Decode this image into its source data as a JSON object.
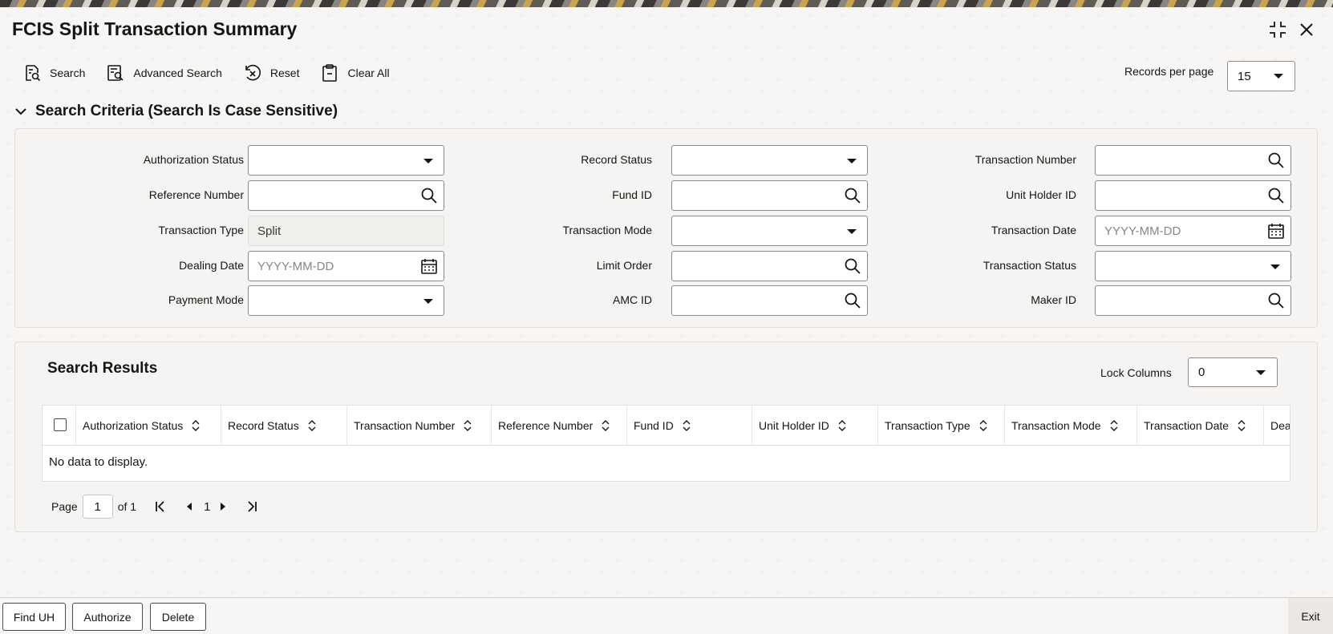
{
  "window": {
    "title": "FCIS Split Transaction Summary"
  },
  "toolbar": {
    "search_label": "Search",
    "advanced_search_label": "Advanced Search",
    "reset_label": "Reset",
    "clear_all_label": "Clear All"
  },
  "records_per_page": {
    "label": "Records per page",
    "value": "15"
  },
  "criteria": {
    "title": "Search Criteria (Search Is Case Sensitive)",
    "authorization_status": {
      "label": "Authorization Status",
      "value": ""
    },
    "record_status": {
      "label": "Record Status",
      "value": ""
    },
    "transaction_number": {
      "label": "Transaction Number",
      "value": ""
    },
    "reference_number": {
      "label": "Reference Number",
      "value": ""
    },
    "fund_id": {
      "label": "Fund ID",
      "value": ""
    },
    "unit_holder_id": {
      "label": "Unit Holder ID",
      "value": ""
    },
    "transaction_type": {
      "label": "Transaction Type",
      "value": "Split"
    },
    "transaction_mode": {
      "label": "Transaction Mode",
      "value": ""
    },
    "transaction_date": {
      "label": "Transaction Date",
      "placeholder": "YYYY-MM-DD"
    },
    "dealing_date": {
      "label": "Dealing Date",
      "placeholder": "YYYY-MM-DD"
    },
    "limit_order": {
      "label": "Limit Order",
      "value": ""
    },
    "transaction_status": {
      "label": "Transaction Status",
      "value": ""
    },
    "payment_mode": {
      "label": "Payment Mode",
      "value": ""
    },
    "amc_id": {
      "label": "AMC ID",
      "value": ""
    },
    "maker_id": {
      "label": "Maker ID",
      "value": ""
    }
  },
  "results": {
    "title": "Search Results",
    "lock_columns": {
      "label": "Lock Columns",
      "value": "0"
    },
    "columns": [
      "Authorization Status",
      "Record Status",
      "Transaction Number",
      "Reference Number",
      "Fund ID",
      "Unit Holder ID",
      "Transaction Type",
      "Transaction Mode",
      "Transaction Date",
      "Dea"
    ],
    "empty_message": "No data to display.",
    "pager": {
      "page_label": "Page",
      "page_value": "1",
      "of_label": "of 1",
      "current": "1"
    }
  },
  "footer": {
    "find_uh": "Find UH",
    "authorize": "Authorize",
    "delete": "Delete",
    "exit": "Exit"
  }
}
